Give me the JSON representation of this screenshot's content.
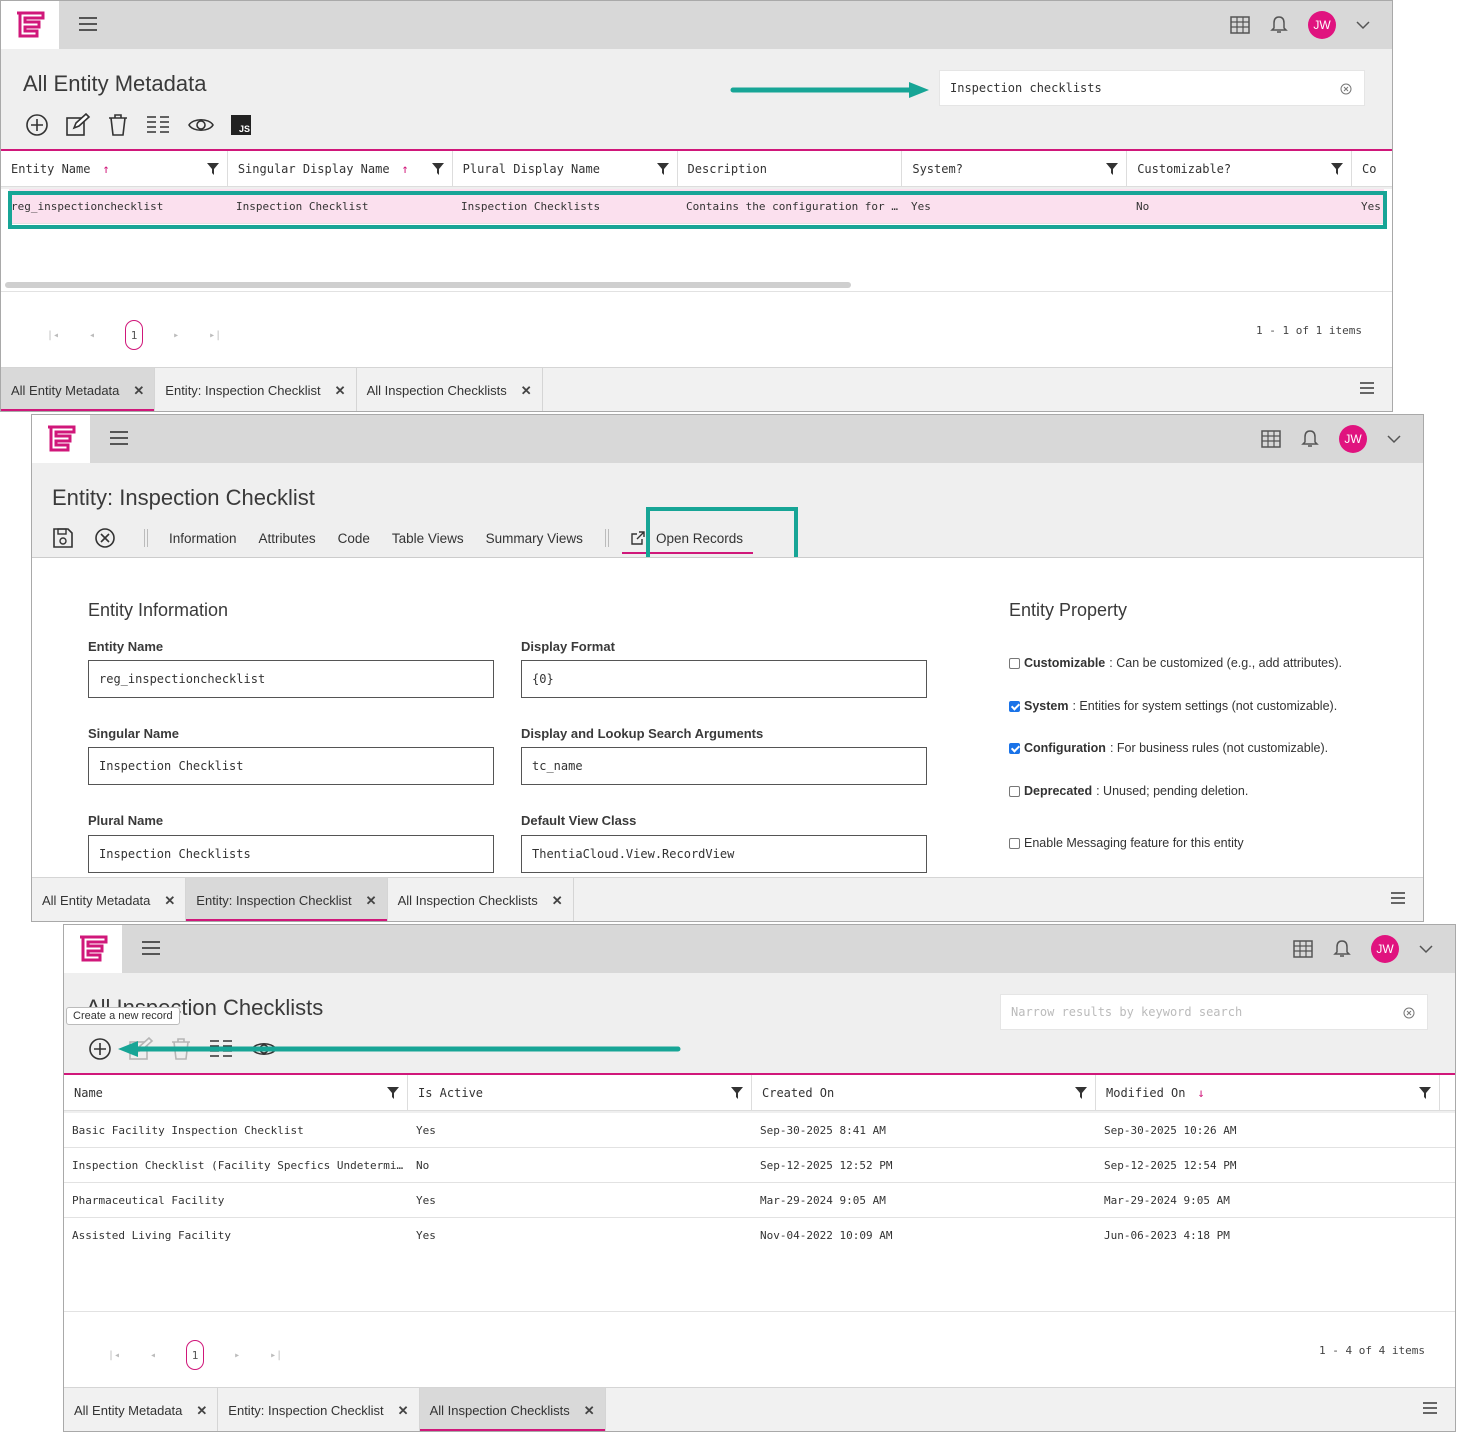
{
  "colors": {
    "accent": "#d0177a",
    "highlight": "#17a596",
    "avatar": "#e0137f"
  },
  "user_initials": "JW",
  "panel1": {
    "title": "All Entity Metadata",
    "search_value": "Inspection checklists",
    "toolbar_icons": [
      "add-icon",
      "edit-icon",
      "delete-icon",
      "columns-icon",
      "view-icon",
      "js-icon"
    ],
    "js_label": "JS",
    "columns": [
      "Entity Name",
      "Singular Display Name",
      "Plural Display Name",
      "Description",
      "System?",
      "Customizable?",
      "Co"
    ],
    "row": [
      "reg_inspectionchecklist",
      "Inspection Checklist",
      "Inspection Checklists",
      "Contains the configuration for a…",
      "Yes",
      "No",
      "Yes"
    ],
    "page": "1",
    "count": "1 - 1 of 1 items"
  },
  "panel2": {
    "title": "Entity: Inspection Checklist",
    "nav": [
      "Information",
      "Attributes",
      "Code",
      "Table Views",
      "Summary Views"
    ],
    "open_records": "Open Records",
    "info_title": "Entity Information",
    "fields": [
      {
        "label": "Entity Name",
        "value": "reg_inspectionchecklist"
      },
      {
        "label": "Display Format",
        "value": "{0}"
      },
      {
        "label": "Singular Name",
        "value": "Inspection Checklist"
      },
      {
        "label": "Display and Lookup Search Arguments",
        "value": "tc_name"
      },
      {
        "label": "Plural Name",
        "value": "Inspection Checklists"
      },
      {
        "label": "Default View Class",
        "value": "ThentiaCloud.View.RecordView"
      }
    ],
    "property_title": "Entity Property",
    "properties": [
      {
        "name": "Customizable",
        "desc": ": Can be customized (e.g., add attributes).",
        "checked": false
      },
      {
        "name": "System",
        "desc": ": Entities for system settings (not customizable).",
        "checked": true
      },
      {
        "name": "Configuration",
        "desc": ": For business rules (not customizable).",
        "checked": true
      },
      {
        "name": "Deprecated",
        "desc": ": Unused; pending deletion.",
        "checked": false
      }
    ],
    "messaging": "Enable Messaging feature for this entity"
  },
  "panel3": {
    "title": "All Inspection Checklists",
    "search_placeholder": "Narrow results by keyword search",
    "tooltip": "Create a new record",
    "columns": [
      "Name",
      "Is Active",
      "Created On",
      "Modified On"
    ],
    "rows": [
      [
        "Basic Facility Inspection Checklist",
        "Yes",
        "Sep-30-2025 8:41 AM",
        "Sep-30-2025 10:26 AM"
      ],
      [
        "Inspection Checklist (Facility Specfics Undetermine…",
        "No",
        "Sep-12-2025 12:52 PM",
        "Sep-12-2025 12:54 PM"
      ],
      [
        "Pharmaceutical Facility",
        "Yes",
        "Mar-29-2024 9:05 AM",
        "Mar-29-2024 9:05 AM"
      ],
      [
        "Assisted Living Facility",
        "Yes",
        "Nov-04-2022 10:09 AM",
        "Jun-06-2023 4:18 PM"
      ]
    ],
    "page": "1",
    "count": "1 - 4 of 4 items"
  },
  "tabs": [
    "All Entity Metadata",
    "Entity: Inspection Checklist",
    "All Inspection Checklists"
  ]
}
